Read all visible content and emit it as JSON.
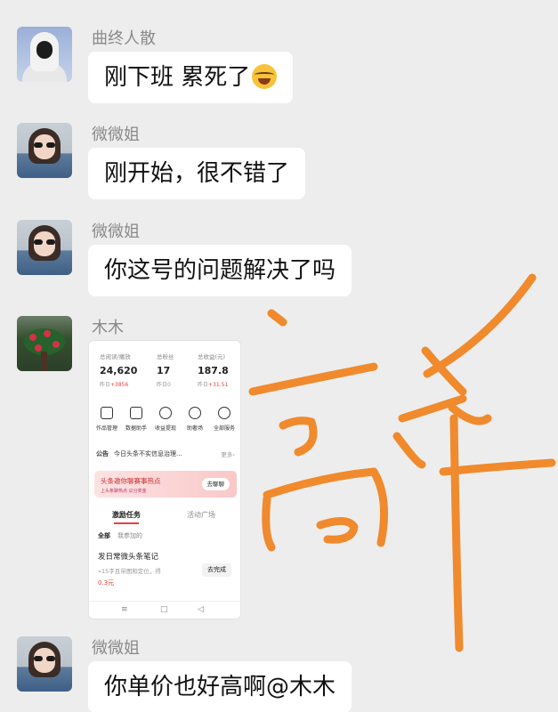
{
  "messages": [
    {
      "sender": "曲终人散",
      "text": "刚下班 累死了",
      "avatar": "hooded-figure-avatar"
    },
    {
      "sender": "微微姐",
      "text": "刚开始，很不错了",
      "avatar": "girl-sunglasses-avatar"
    },
    {
      "sender": "微微姐",
      "text": "你这号的问题解决了吗",
      "avatar": "girl-sunglasses-avatar"
    },
    {
      "sender": "木木",
      "avatar": "tree-flowers-avatar"
    },
    {
      "sender": "微微姐",
      "text": "你单价也好高啊@木木",
      "avatar": "girl-sunglasses-avatar"
    }
  ],
  "emoji_icon": "crying-laughing-emoji",
  "shot": {
    "stats": [
      {
        "label": "总阅读/播放",
        "value": "24,620",
        "sub_prefix": "昨日",
        "sub_delta": "+3856"
      },
      {
        "label": "总粉丝",
        "value": "17",
        "sub_prefix": "昨日0",
        "sub_delta": ""
      },
      {
        "label": "总收益(元)",
        "value": "187.8",
        "sub_prefix": "昨日",
        "sub_delta": "+31.51"
      }
    ],
    "tools": [
      "作品管理",
      "数据助手",
      "收益提现",
      "助奢场",
      "全部服务"
    ],
    "notice": {
      "tag": "公告",
      "text": "今日头条不实信息治理...",
      "more": "更多›"
    },
    "banner": {
      "title": "头条邀你聊赛事热点",
      "subtitle": "上头条聊热点 瓜分奖金",
      "button": "去聊聊"
    },
    "tabs": {
      "active": "激励任务",
      "other": "活动广场"
    },
    "filter": {
      "all": "全部",
      "mine": "我参加的"
    },
    "task": {
      "title": "发日常微头条笔记",
      "desc": "»15字且带图和定位，得",
      "reward": "0.3元",
      "button": "去完成"
    },
    "nav": [
      "≡",
      "□",
      "◁"
    ]
  },
  "handwriting": {
    "text": "高单",
    "color": "#f08a2c"
  }
}
